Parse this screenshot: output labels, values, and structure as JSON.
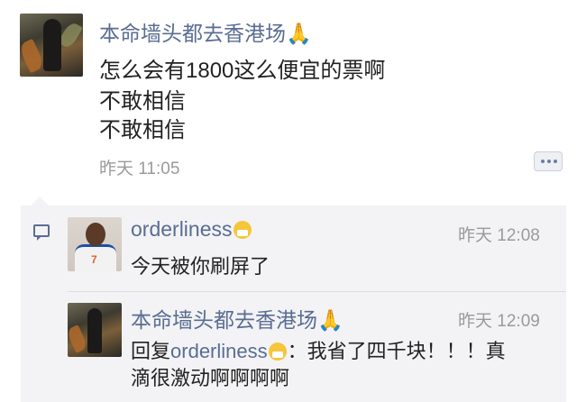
{
  "post": {
    "author": "本命墙头都去香港场",
    "author_emoji": "🙏",
    "lines": [
      "怎么会有1800这么便宜的票啊",
      "不敢相信",
      "不敢相信"
    ],
    "time": "昨天 11:05"
  },
  "comments": [
    {
      "name": "orderliness",
      "name_emoji": "mask-face-emoji",
      "time": "昨天 12:08",
      "text": "今天被你刷屏了"
    },
    {
      "name": "本命墙头都去香港场",
      "name_emoji": "🙏",
      "time": "昨天 12:09",
      "reply_prefix": "回复",
      "reply_to": "orderliness",
      "reply_after": "：我省了四千块！！！真",
      "text_line2": "滴很激动啊啊啊啊"
    }
  ],
  "colors": {
    "name_link": "#5a6d92",
    "time_gray": "#9a9a9a",
    "panel_bg": "#f3f3f5"
  },
  "icons": {
    "comment_button": "more-dots-icon",
    "comment_indicator": "comment-bubble-icon"
  }
}
